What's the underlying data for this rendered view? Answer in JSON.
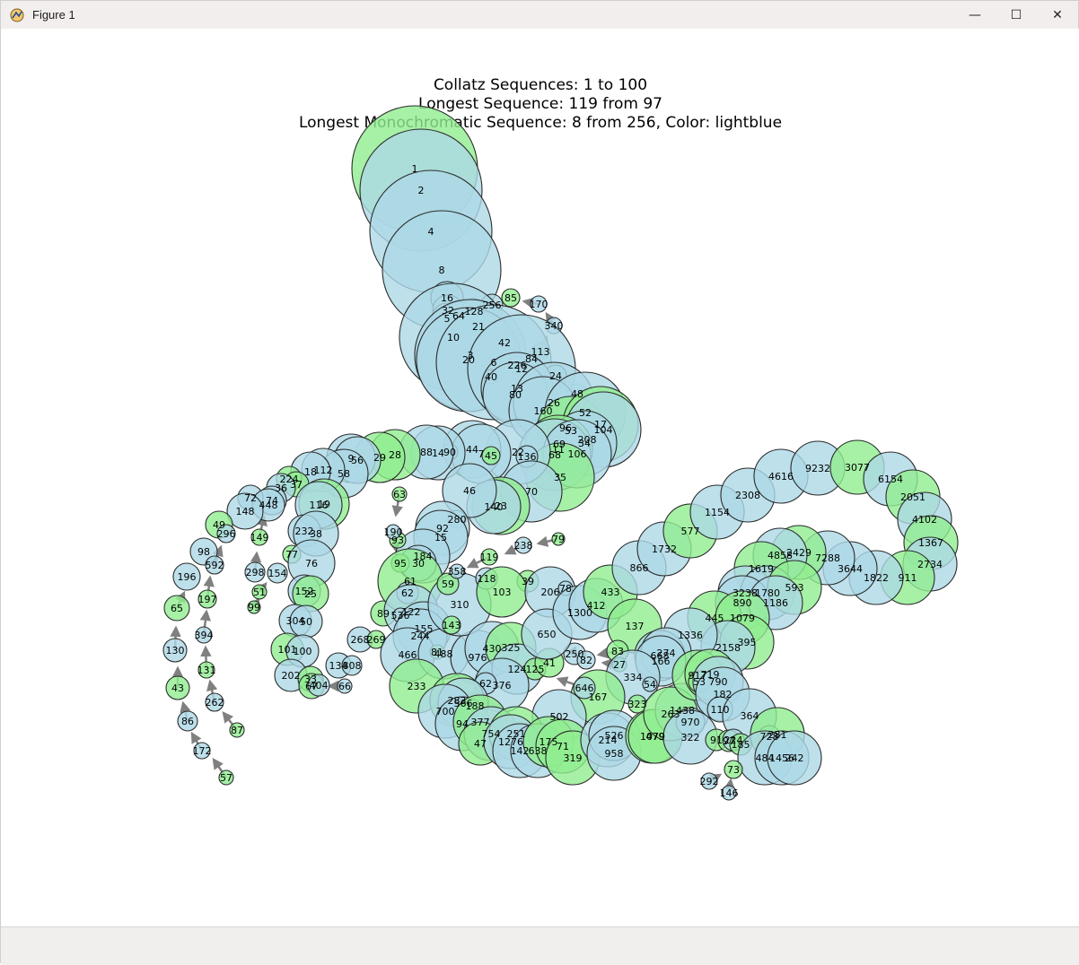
{
  "window": {
    "title": "Figure 1",
    "app_icon": "matplotlib-figure-icon",
    "controls": {
      "minimize": "—",
      "maximize": "☐",
      "close": "✕"
    }
  },
  "chart_data": {
    "type": "scatter",
    "title_lines": [
      "Collatz Sequences: 1 to 100",
      "Longest Sequence: 119 from 97",
      "Longest Monochromatic Sequence: 8 from 256, Color: lightblue"
    ],
    "colors": {
      "lightblue": "#add8e6",
      "lightgreen": "#90ee90",
      "edge": "#2b2b2b",
      "arrow": "#808080"
    },
    "node_label_font_size_note": "numbers drawn inside circles",
    "nodes": [
      {
        "n": 1,
        "c": "g"
      },
      {
        "n": 2,
        "c": "b"
      },
      {
        "n": 4,
        "c": "b"
      },
      {
        "n": 8,
        "c": "b"
      },
      {
        "n": 16,
        "c": "b"
      },
      {
        "n": 32,
        "c": "b"
      },
      {
        "n": 5,
        "c": "b"
      },
      {
        "n": 64,
        "c": "b"
      },
      {
        "n": 128,
        "c": "b"
      },
      {
        "n": 256,
        "c": "b"
      },
      {
        "n": 85,
        "c": "g"
      },
      {
        "n": 170,
        "c": "b"
      },
      {
        "n": 340,
        "c": "b"
      },
      {
        "n": 113,
        "c": "g"
      },
      {
        "n": 21,
        "c": "g"
      },
      {
        "n": 10,
        "c": "b"
      },
      {
        "n": 42,
        "c": "b"
      },
      {
        "n": 84,
        "c": "b"
      },
      {
        "n": 3,
        "c": "b"
      },
      {
        "n": 20,
        "c": "b"
      },
      {
        "n": 6,
        "c": "b"
      },
      {
        "n": 226,
        "c": "b"
      },
      {
        "n": 12,
        "c": "b"
      },
      {
        "n": 40,
        "c": "b"
      },
      {
        "n": 24,
        "c": "b"
      },
      {
        "n": 13,
        "c": "b"
      },
      {
        "n": 80,
        "c": "b"
      },
      {
        "n": 48,
        "c": "b"
      },
      {
        "n": 26,
        "c": "b"
      },
      {
        "n": 160,
        "c": "b"
      },
      {
        "n": 52,
        "c": "b"
      },
      {
        "n": 96,
        "c": "b"
      },
      {
        "n": 53,
        "c": "g"
      },
      {
        "n": 17,
        "c": "g"
      },
      {
        "n": 104,
        "c": "b"
      },
      {
        "n": 208,
        "c": "b"
      },
      {
        "n": 34,
        "c": "b"
      },
      {
        "n": 69,
        "c": "g"
      },
      {
        "n": 11,
        "c": "g"
      },
      {
        "n": 68,
        "c": "b"
      },
      {
        "n": 106,
        "c": "b"
      },
      {
        "n": 35,
        "c": "g"
      },
      {
        "n": 22,
        "c": "b"
      },
      {
        "n": 136,
        "c": "b"
      },
      {
        "n": 44,
        "c": "b"
      },
      {
        "n": 7,
        "c": "b"
      },
      {
        "n": 45,
        "c": "g"
      },
      {
        "n": 90,
        "c": "b"
      },
      {
        "n": 14,
        "c": "b"
      },
      {
        "n": 88,
        "c": "b"
      },
      {
        "n": 28,
        "c": "g"
      },
      {
        "n": 29,
        "c": "g"
      },
      {
        "n": 9,
        "c": "b"
      },
      {
        "n": 56,
        "c": "b"
      },
      {
        "n": 58,
        "c": "b"
      },
      {
        "n": 112,
        "c": "b"
      },
      {
        "n": 18,
        "c": "b"
      },
      {
        "n": 224,
        "c": "g"
      },
      {
        "n": 37,
        "c": "g"
      },
      {
        "n": 36,
        "c": "b"
      },
      {
        "n": 74,
        "c": "b"
      },
      {
        "n": 72,
        "c": "b"
      },
      {
        "n": 448,
        "c": "b"
      },
      {
        "n": 148,
        "c": "b"
      },
      {
        "n": 19,
        "c": "g"
      },
      {
        "n": 116,
        "c": "b"
      },
      {
        "n": 70,
        "c": "b"
      },
      {
        "n": 23,
        "c": "g"
      },
      {
        "n": 140,
        "c": "b"
      },
      {
        "n": 46,
        "c": "b"
      },
      {
        "n": 280,
        "c": "b"
      },
      {
        "n": 92,
        "c": "b"
      },
      {
        "n": 15,
        "c": "b"
      },
      {
        "n": 184,
        "c": "b"
      },
      {
        "n": 30,
        "c": "b"
      },
      {
        "n": 93,
        "c": "g"
      },
      {
        "n": 95,
        "c": "g"
      },
      {
        "n": 190,
        "c": "b"
      },
      {
        "n": 63,
        "c": "g"
      },
      {
        "n": 49,
        "c": "g"
      },
      {
        "n": 296,
        "c": "b"
      },
      {
        "n": 98,
        "c": "b"
      },
      {
        "n": 592,
        "c": "b"
      },
      {
        "n": 196,
        "c": "b"
      },
      {
        "n": 197,
        "c": "g"
      },
      {
        "n": 65,
        "c": "g"
      },
      {
        "n": 394,
        "c": "b"
      },
      {
        "n": 130,
        "c": "b"
      },
      {
        "n": 131,
        "c": "g"
      },
      {
        "n": 43,
        "c": "g"
      },
      {
        "n": 262,
        "c": "b"
      },
      {
        "n": 86,
        "c": "b"
      },
      {
        "n": 87,
        "c": "g"
      },
      {
        "n": 172,
        "c": "b"
      },
      {
        "n": 57,
        "c": "g"
      },
      {
        "n": 149,
        "c": "g"
      },
      {
        "n": 298,
        "c": "b"
      },
      {
        "n": 154,
        "c": "b"
      },
      {
        "n": 51,
        "c": "g"
      },
      {
        "n": 99,
        "c": "g"
      },
      {
        "n": 77,
        "c": "g"
      },
      {
        "n": 232,
        "c": "b"
      },
      {
        "n": 38,
        "c": "b"
      },
      {
        "n": 76,
        "c": "b"
      },
      {
        "n": 152,
        "c": "b"
      },
      {
        "n": 25,
        "c": "g"
      },
      {
        "n": 304,
        "c": "b"
      },
      {
        "n": 50,
        "c": "b"
      },
      {
        "n": 101,
        "c": "g"
      },
      {
        "n": 100,
        "c": "b"
      },
      {
        "n": 202,
        "c": "b"
      },
      {
        "n": 33,
        "c": "g"
      },
      {
        "n": 67,
        "c": "g"
      },
      {
        "n": 404,
        "c": "b"
      },
      {
        "n": 134,
        "c": "b"
      },
      {
        "n": 808,
        "c": "b"
      },
      {
        "n": 66,
        "c": "b"
      },
      {
        "n": 268,
        "c": "b"
      },
      {
        "n": 269,
        "c": "g"
      },
      {
        "n": 89,
        "c": "g"
      },
      {
        "n": 61,
        "c": "g"
      },
      {
        "n": 62,
        "c": "b"
      },
      {
        "n": 122,
        "c": "b"
      },
      {
        "n": 536,
        "c": "b"
      },
      {
        "n": 155,
        "c": "b"
      },
      {
        "n": 244,
        "c": "b"
      },
      {
        "n": 466,
        "c": "b"
      },
      {
        "n": 81,
        "c": "g"
      },
      {
        "n": 488,
        "c": "b"
      },
      {
        "n": 976,
        "c": "b"
      },
      {
        "n": 233,
        "c": "g"
      },
      {
        "n": 310,
        "c": "b"
      },
      {
        "n": 59,
        "c": "g"
      },
      {
        "n": 358,
        "c": "b"
      },
      {
        "n": 118,
        "c": "b"
      },
      {
        "n": 119,
        "c": "g"
      },
      {
        "n": 238,
        "c": "b"
      },
      {
        "n": 79,
        "c": "g"
      },
      {
        "n": 39,
        "c": "g"
      },
      {
        "n": 103,
        "c": "g"
      },
      {
        "n": 206,
        "c": "b"
      },
      {
        "n": 78,
        "c": "b"
      },
      {
        "n": 143,
        "c": "g"
      },
      {
        "n": 430,
        "c": "b"
      },
      {
        "n": 325,
        "c": "g"
      },
      {
        "n": 124,
        "c": "b"
      },
      {
        "n": 125,
        "c": "g"
      },
      {
        "n": 41,
        "c": "g"
      },
      {
        "n": 250,
        "c": "b"
      },
      {
        "n": 82,
        "c": "b"
      },
      {
        "n": 650,
        "c": "b"
      },
      {
        "n": 1300,
        "c": "b"
      },
      {
        "n": 412,
        "c": "b"
      },
      {
        "n": 433,
        "c": "g"
      },
      {
        "n": 866,
        "c": "b"
      },
      {
        "n": 1732,
        "c": "b"
      },
      {
        "n": 577,
        "c": "g"
      },
      {
        "n": 1154,
        "c": "b"
      },
      {
        "n": 2308,
        "c": "b"
      },
      {
        "n": 4616,
        "c": "b"
      },
      {
        "n": 9232,
        "c": "b"
      },
      {
        "n": 3077,
        "c": "g"
      },
      {
        "n": 6154,
        "c": "b"
      },
      {
        "n": 2051,
        "c": "g"
      },
      {
        "n": 4102,
        "c": "b"
      },
      {
        "n": 1367,
        "c": "g"
      },
      {
        "n": 2734,
        "c": "b"
      },
      {
        "n": 911,
        "c": "g"
      },
      {
        "n": 1822,
        "c": "b"
      },
      {
        "n": 3644,
        "c": "b"
      },
      {
        "n": 7288,
        "c": "b"
      },
      {
        "n": 2429,
        "c": "g"
      },
      {
        "n": 4858,
        "c": "b"
      },
      {
        "n": 1619,
        "c": "g"
      },
      {
        "n": 3238,
        "c": "b"
      },
      {
        "n": 1780,
        "c": "b"
      },
      {
        "n": 593,
        "c": "g"
      },
      {
        "n": 890,
        "c": "b"
      },
      {
        "n": 1186,
        "c": "b"
      },
      {
        "n": 445,
        "c": "g"
      },
      {
        "n": 1079,
        "c": "g"
      },
      {
        "n": 395,
        "c": "g"
      },
      {
        "n": 2158,
        "c": "b"
      },
      {
        "n": 1336,
        "c": "b"
      },
      {
        "n": 137,
        "c": "g"
      },
      {
        "n": 83,
        "c": "g"
      },
      {
        "n": 27,
        "c": "g"
      },
      {
        "n": 668,
        "c": "b"
      },
      {
        "n": 274,
        "c": "b"
      },
      {
        "n": 166,
        "c": "b"
      },
      {
        "n": 334,
        "c": "b"
      },
      {
        "n": 54,
        "c": "b"
      },
      {
        "n": 167,
        "c": "g"
      },
      {
        "n": 646,
        "c": "b"
      },
      {
        "n": 323,
        "c": "g"
      },
      {
        "n": 502,
        "c": "b"
      },
      {
        "n": 376,
        "c": "b"
      },
      {
        "n": 62,
        "c": "b"
      },
      {
        "n": 188,
        "c": "b"
      },
      {
        "n": 283,
        "c": "g"
      },
      {
        "n": 566,
        "c": "b"
      },
      {
        "n": 700,
        "c": "b"
      },
      {
        "n": 94,
        "c": "b"
      },
      {
        "n": 377,
        "c": "g"
      },
      {
        "n": 754,
        "c": "b"
      },
      {
        "n": 47,
        "c": "g"
      },
      {
        "n": 251,
        "c": "g"
      },
      {
        "n": 1276,
        "c": "b"
      },
      {
        "n": 142,
        "c": "b"
      },
      {
        "n": 638,
        "c": "b"
      },
      {
        "n": 175,
        "c": "g"
      },
      {
        "n": 71,
        "c": "g"
      },
      {
        "n": 319,
        "c": "g"
      },
      {
        "n": 214,
        "c": "b"
      },
      {
        "n": 526,
        "c": "b"
      },
      {
        "n": 958,
        "c": "b"
      },
      {
        "n": 1079,
        "c": "g"
      },
      {
        "n": 479,
        "c": "g"
      },
      {
        "n": 1438,
        "c": "b"
      },
      {
        "n": 263,
        "c": "g"
      },
      {
        "n": 970,
        "c": "b"
      },
      {
        "n": 322,
        "c": "b"
      },
      {
        "n": 917,
        "c": "g"
      },
      {
        "n": 719,
        "c": "g"
      },
      {
        "n": 53,
        "c": "g"
      },
      {
        "n": 790,
        "c": "b"
      },
      {
        "n": 182,
        "c": "b"
      },
      {
        "n": 110,
        "c": "b"
      },
      {
        "n": 364,
        "c": "b"
      },
      {
        "n": 91,
        "c": "g"
      },
      {
        "n": 728,
        "c": "b"
      },
      {
        "n": 281,
        "c": "g"
      },
      {
        "n": 97,
        "c": "g"
      },
      {
        "n": 224,
        "c": "b"
      },
      {
        "n": 185,
        "c": "g"
      },
      {
        "n": 484,
        "c": "b"
      },
      {
        "n": 1456,
        "c": "b"
      },
      {
        "n": 242,
        "c": "b"
      },
      {
        "n": 73,
        "c": "g"
      },
      {
        "n": 292,
        "c": "b"
      },
      {
        "n": 146,
        "c": "b"
      }
    ]
  },
  "statusbar": {
    "text": ""
  }
}
